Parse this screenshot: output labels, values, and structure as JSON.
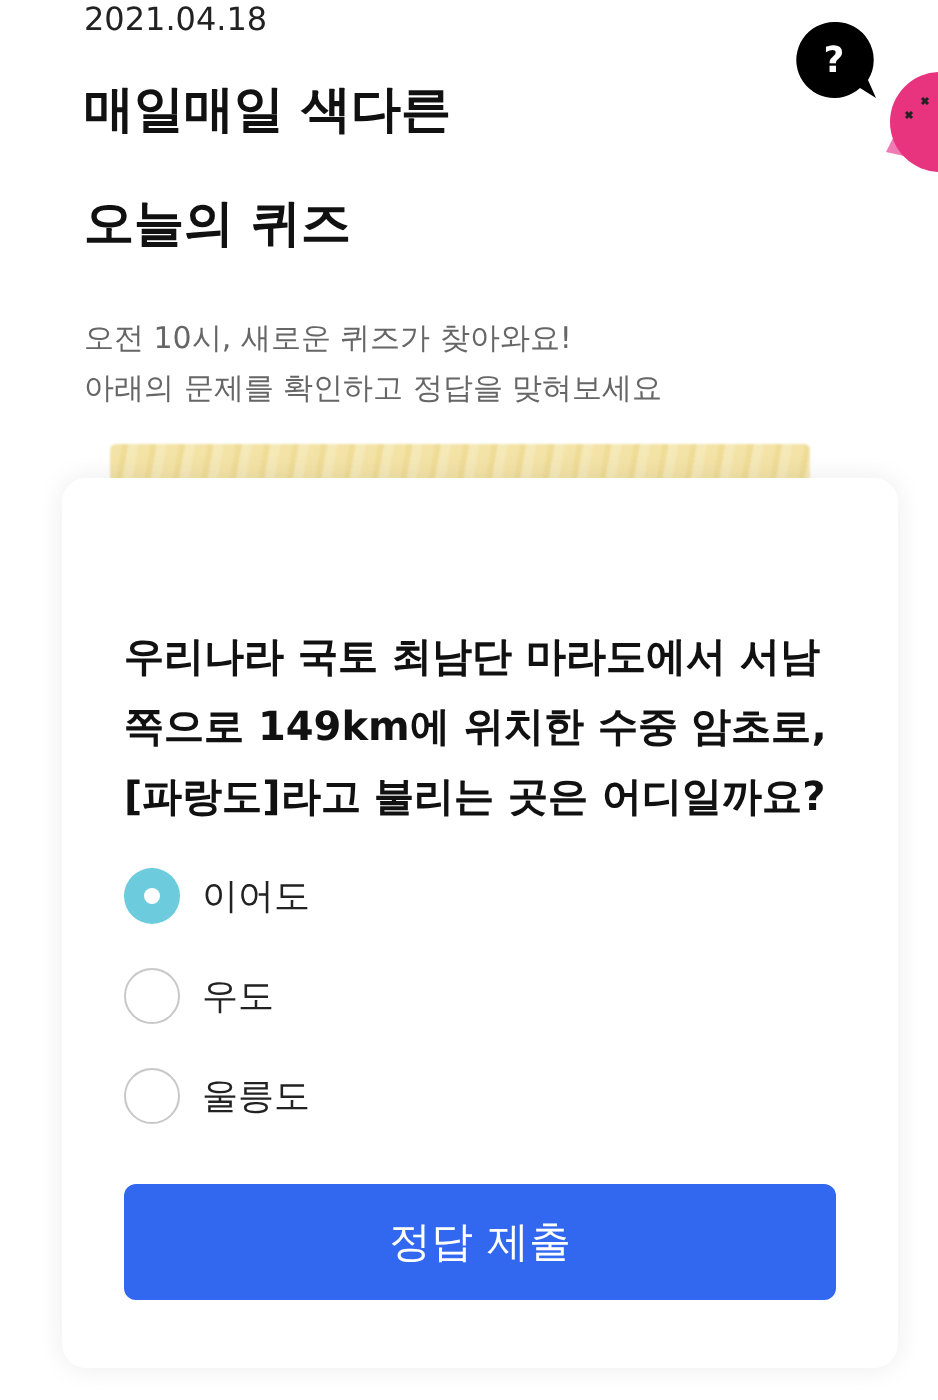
{
  "header": {
    "date": "2021.04.18",
    "title_lines": [
      "매일매일 색다른",
      "오늘의 퀴즈"
    ],
    "subtitle_lines": [
      "오전 10시, 새로운 퀴즈가 찾아와요!",
      "아래의 문제를 확인하고 정답을 맞혀보세요"
    ],
    "bubble": "?"
  },
  "quiz": {
    "question": "우리나라 국토 최남단 마라도에서 서남쪽으로 149km에 위치한 수중 암초로, [파랑도]라고 불리는 곳은 어디일까요?",
    "options": [
      {
        "label": "이어도",
        "selected": true
      },
      {
        "label": "우도",
        "selected": false
      },
      {
        "label": "울릉도",
        "selected": false
      }
    ],
    "submit": "정답 제출"
  }
}
